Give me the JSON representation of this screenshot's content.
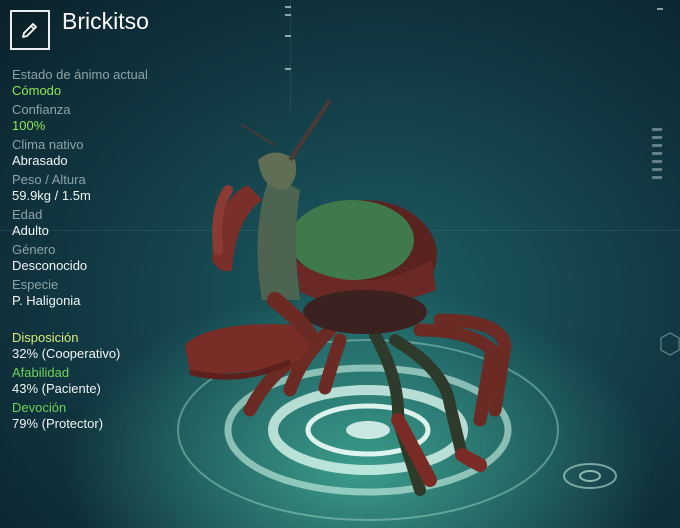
{
  "creature": {
    "name": "Brickitso"
  },
  "stats": [
    {
      "label": "Estado de ánimo actual",
      "value": "Cómodo",
      "highlight": true
    },
    {
      "label": "Confianza",
      "value": "100%",
      "highlight": true
    },
    {
      "label": "Clima nativo",
      "value": "Abrasado",
      "highlight": false
    },
    {
      "label": "Peso / Altura",
      "value": "59.9kg / 1.5m",
      "highlight": false
    },
    {
      "label": "Edad",
      "value": "Adulto",
      "highlight": false
    },
    {
      "label": "Género",
      "value": "Desconocido",
      "highlight": false
    },
    {
      "label": "Especie",
      "value": "P. Haligonia",
      "highlight": false
    }
  ],
  "traits": [
    {
      "label": "Disposición",
      "value": "32% (Cooperativo)",
      "level": 0.32,
      "color": "#d9e87a"
    },
    {
      "label": "Afabilidad",
      "value": "43% (Paciente)",
      "level": 0.43,
      "color": "#6fd35a"
    },
    {
      "label": "Devoción",
      "value": "79% (Protector)",
      "level": 0.79,
      "color": "#6fd35a"
    }
  ],
  "icons": {
    "edit": "pencil-icon"
  }
}
